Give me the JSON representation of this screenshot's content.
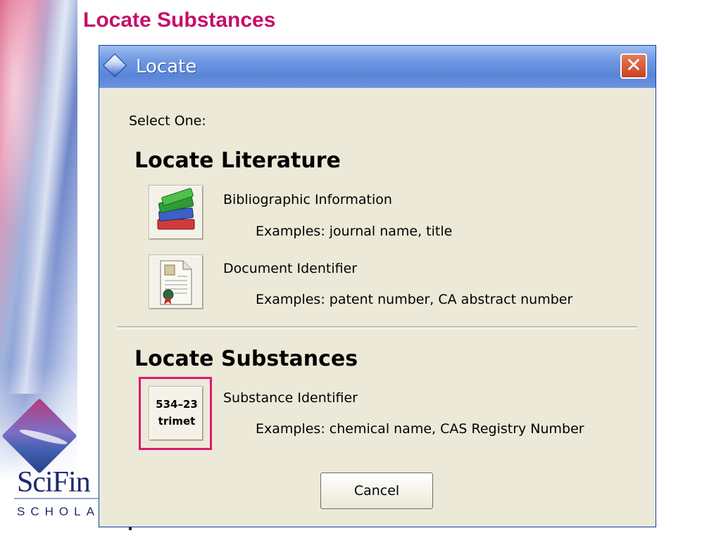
{
  "slide": {
    "title": "Locate Substances",
    "logo_name": "SciFin",
    "logo_sub": "SCHOLA"
  },
  "dialog": {
    "title": "Locate",
    "close_label": "✕",
    "prompt": "Select One:",
    "sections": [
      {
        "heading": "Locate Literature",
        "options": [
          {
            "title": "Bibliographic Information",
            "example": "Examples: journal name, title",
            "icon": "books-icon"
          },
          {
            "title": "Document Identifier",
            "example": "Examples: patent number, CA abstract number",
            "icon": "document-icon"
          }
        ]
      },
      {
        "heading": "Locate Substances",
        "options": [
          {
            "title": "Substance Identifier",
            "example": "Examples: chemical name, CAS Registry Number",
            "icon": "substance-identifier-icon",
            "icon_line1": "534–23",
            "icon_line2": "trimet"
          }
        ]
      }
    ],
    "cancel_label": "Cancel"
  },
  "colors": {
    "title_pink": "#c4106a",
    "highlight_pink": "#e0186f",
    "dialog_bg": "#ece9d8",
    "titlebar_blue": "#6f98e2"
  }
}
